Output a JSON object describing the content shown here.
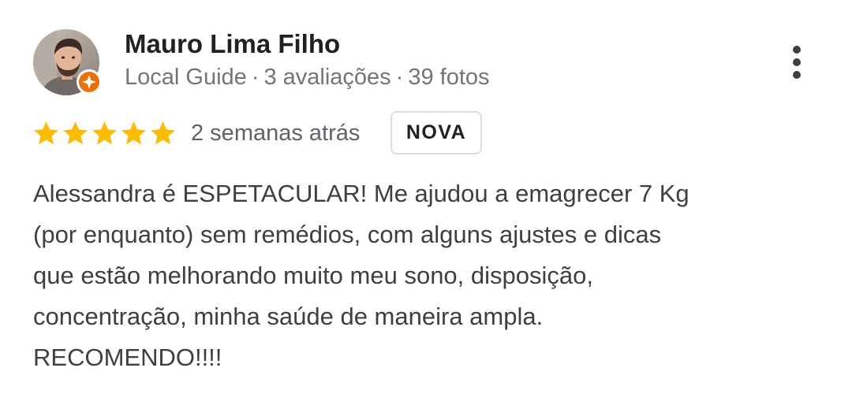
{
  "reviewer": {
    "name": "Mauro Lima Filho",
    "level": "Local Guide",
    "reviews": "3 avaliações",
    "photos": "39 fotos",
    "separator": "·"
  },
  "rating": {
    "stars": 5,
    "max_stars": 5,
    "date": "2 semanas atrás",
    "badge": "NOVA"
  },
  "review": {
    "lines": [
      "Alessandra é ESPETACULAR! Me ajudou a emagrecer 7 Kg",
      "(por enquanto) sem remédios, com alguns ajustes e dicas",
      "que estão melhorando muito meu sono, disposição,",
      "concentração, minha saúde de maneira ampla.",
      "RECOMENDO!!!!"
    ]
  },
  "colors": {
    "star": "#fbbc04",
    "badge_orange": "#e8710a",
    "meta_text": "#70757a"
  },
  "icons": {
    "avatar": "avatar-photo",
    "badge": "local-guide-badge-icon",
    "menu": "more-vert-icon",
    "star": "star-icon"
  }
}
